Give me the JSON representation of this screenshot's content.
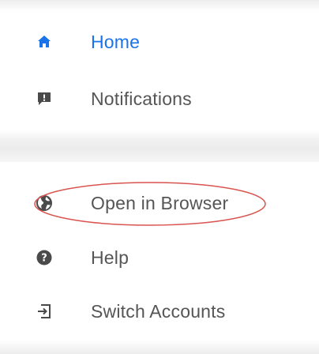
{
  "menu": {
    "items": [
      {
        "label": "Home",
        "icon": "home-icon",
        "active": true
      },
      {
        "label": "Notifications",
        "icon": "notifications-icon",
        "active": false
      },
      {
        "label": "Open in Browser",
        "icon": "globe-icon",
        "active": false
      },
      {
        "label": "Help",
        "icon": "help-icon",
        "active": false
      },
      {
        "label": "Switch Accounts",
        "icon": "switch-accounts-icon",
        "active": false
      }
    ]
  },
  "colors": {
    "active": "#1a73e8",
    "text": "#555555",
    "icon": "#4a4a4a",
    "annotation": "#d9534f"
  }
}
